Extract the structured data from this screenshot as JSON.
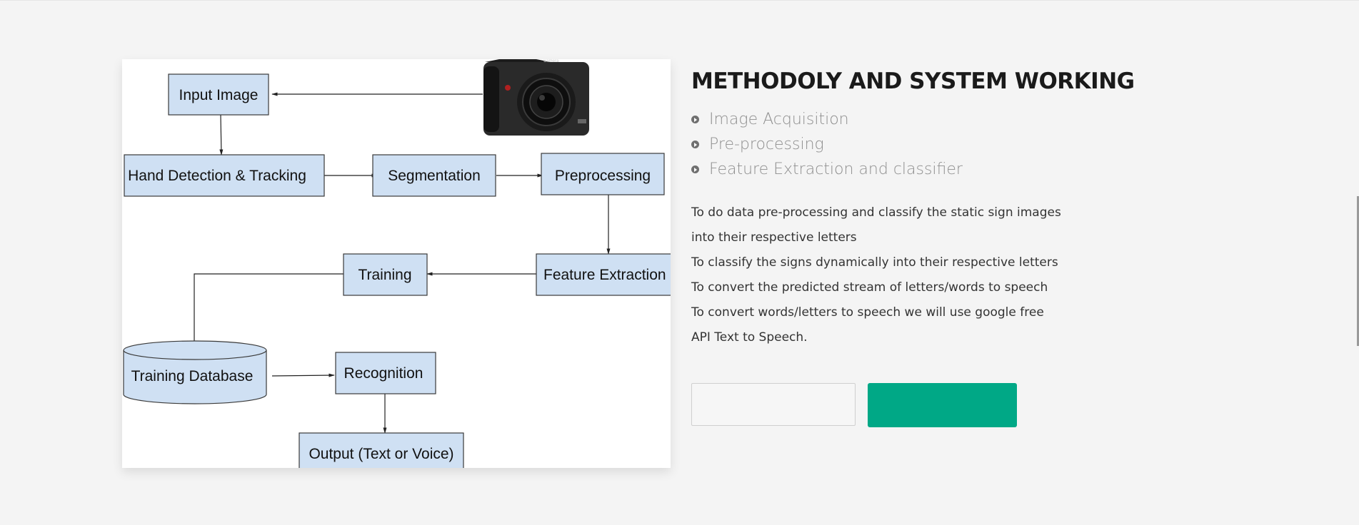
{
  "section": {
    "title": "METHODOLY AND SYSTEM WORKING",
    "bullets": [
      {
        "label": "Image Acquisition",
        "icon": "circle-arrow-icon"
      },
      {
        "label": "Pre-processing",
        "icon": "circle-arrow-icon"
      },
      {
        "label": "Feature Extraction and classifier",
        "icon": "circle-arrow-icon"
      }
    ],
    "description_lines": [
      "To do data pre-processing and classify the static sign images",
      "into their respective letters",
      "To classify the signs dynamically into their respective letters",
      "To convert the predicted stream of letters/words to speech",
      "To convert words/letters to speech we will use google free",
      "API Text to Speech."
    ]
  },
  "diagram": {
    "nodes": {
      "input_image": "Input Image",
      "hand_detection": "Hand Detection & Tracking",
      "segmentation": "Segmentation",
      "preprocessing": "Preprocessing",
      "feature_extraction": "Feature Extraction",
      "training": "Training",
      "training_database": "Training Database",
      "recognition": "Recognition",
      "output": "Output (Text or Voice)"
    },
    "camera_label": "Camera"
  },
  "buttons": {
    "secondary_label": "",
    "primary_label": ""
  },
  "colors": {
    "background": "#f4f4f4",
    "node_fill": "#cfe0f3",
    "primary_button": "#00a886",
    "title": "#1a1a1a",
    "bullet_text": "#8f8f8f"
  }
}
